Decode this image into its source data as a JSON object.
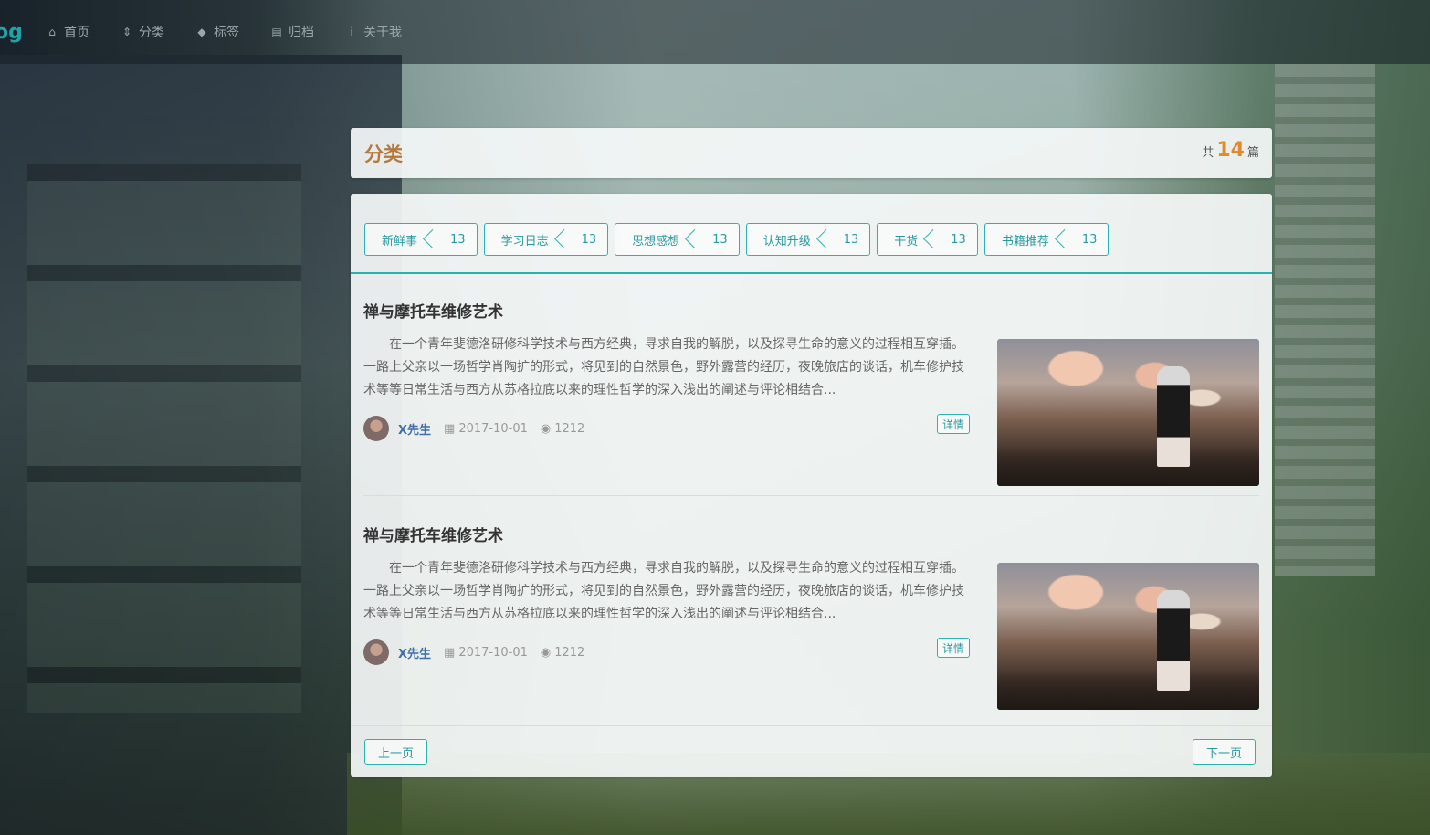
{
  "nav": {
    "brand": "og",
    "items": [
      {
        "label": "首页",
        "icon": "home-icon"
      },
      {
        "label": "分类",
        "icon": "sort-icon"
      },
      {
        "label": "标签",
        "icon": "tags-icon"
      },
      {
        "label": "归档",
        "icon": "archive-icon"
      },
      {
        "label": "关于我",
        "icon": "info-icon"
      }
    ]
  },
  "header": {
    "title": "分类",
    "count_prefix": "共",
    "count": "14",
    "count_suffix": "篇"
  },
  "categories": [
    {
      "name": "新鲜事",
      "count": "13"
    },
    {
      "name": "学习日志",
      "count": "13"
    },
    {
      "name": "思想感想",
      "count": "13"
    },
    {
      "name": "认知升级",
      "count": "13"
    },
    {
      "name": "干货",
      "count": "13"
    },
    {
      "name": "书籍推荐",
      "count": "13"
    }
  ],
  "posts": [
    {
      "title": "禅与摩托车维修艺术",
      "excerpt": "在一个青年斐德洛研修科学技术与西方经典，寻求自我的解脱，以及探寻生命的意义的过程相互穿插。一路上父亲以一场哲学肖陶扩的形式，将见到的自然景色，野外露营的经历，夜晚旅店的谈话，机车修护技术等等日常生活与西方从苏格拉底以来的理性哲学的深入浅出的阐述与评论相结合...",
      "author": "X先生",
      "date": "2017-10-01",
      "views": "1212",
      "detail_label": "详情"
    },
    {
      "title": "禅与摩托车维修艺术",
      "excerpt": "在一个青年斐德洛研修科学技术与西方经典，寻求自我的解脱，以及探寻生命的意义的过程相互穿插。一路上父亲以一场哲学肖陶扩的形式，将见到的自然景色，野外露营的经历，夜晚旅店的谈话，机车修护技术等等日常生活与西方从苏格拉底以来的理性哲学的深入浅出的阐述与评论相结合...",
      "author": "X先生",
      "date": "2017-10-01",
      "views": "1212",
      "detail_label": "详情"
    }
  ],
  "pager": {
    "prev_label": "上一页",
    "next_label": "下一页"
  },
  "colors": {
    "accent": "#2bb3ae",
    "title": "#b5793e",
    "count": "#e08a2c",
    "author": "#3f6fa8"
  }
}
